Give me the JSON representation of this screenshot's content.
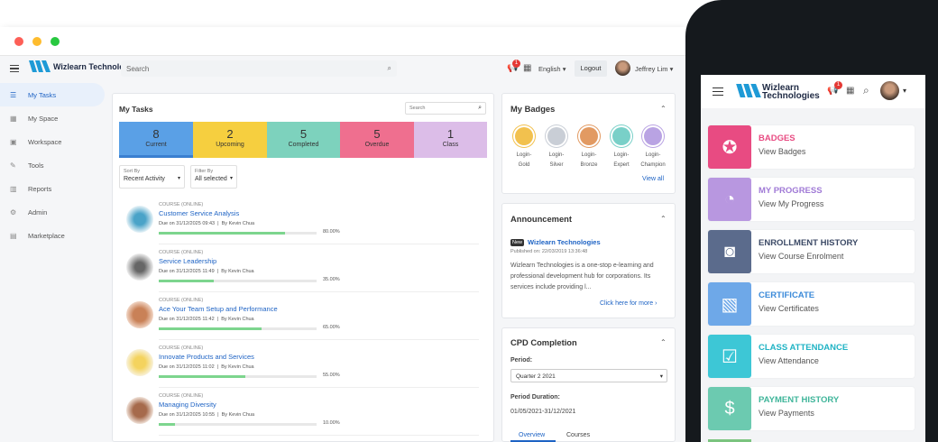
{
  "header": {
    "search_placeholder": "Search",
    "language": "English",
    "logout": "Logout",
    "user": "Jeffrey Lim",
    "notif_count": "1",
    "logo": "Wizlearn Technologies"
  },
  "sidebar": {
    "items": [
      {
        "label": "My Tasks",
        "icon": "tasks-icon"
      },
      {
        "label": "My Space",
        "icon": "grid-icon"
      },
      {
        "label": "Workspace",
        "icon": "briefcase-icon"
      },
      {
        "label": "Tools",
        "icon": "wrench-icon"
      },
      {
        "label": "Reports",
        "icon": "chart-icon"
      },
      {
        "label": "Admin",
        "icon": "gear-icon"
      },
      {
        "label": "Marketplace",
        "icon": "store-icon"
      }
    ]
  },
  "tasks": {
    "title": "My Tasks",
    "search_placeholder": "Search",
    "stats": [
      {
        "n": "8",
        "label": "Current",
        "color": "#5aa0e6"
      },
      {
        "n": "2",
        "label": "Upcoming",
        "color": "#f6cf3f"
      },
      {
        "n": "5",
        "label": "Completed",
        "color": "#7dd2bd"
      },
      {
        "n": "5",
        "label": "Overdue",
        "color": "#ef6f8f"
      },
      {
        "n": "1",
        "label": "Class",
        "color": "#dcbde8"
      }
    ],
    "sort_label": "Sort By",
    "sort_value": "Recent Activity",
    "filter_label": "Filter By",
    "filter_value": "All selected",
    "items": [
      {
        "kind": "COURSE (ONLINE)",
        "title": "Customer Service Analysis",
        "due": "Due on 31/12/2025 09:43",
        "by": "By Kevin Chua",
        "progress": "80.00%",
        "pct": 80
      },
      {
        "kind": "COURSE (ONLINE)",
        "title": "Service Leadership",
        "due": "Due on 31/12/2025 11:49",
        "by": "By Kevin Chua",
        "progress": "35.00%",
        "pct": 35
      },
      {
        "kind": "COURSE (ONLINE)",
        "title": "Ace Your Team Setup and Performance",
        "due": "Due on 31/12/2025 11:42",
        "by": "By Kevin Chua",
        "progress": "65.00%",
        "pct": 65
      },
      {
        "kind": "COURSE (ONLINE)",
        "title": "Innovate Products and Services",
        "due": "Due on 31/12/2025 11:02",
        "by": "By Kevin Chua",
        "progress": "55.00%",
        "pct": 55
      },
      {
        "kind": "COURSE (ONLINE)",
        "title": "Managing Diversity",
        "due": "Due on 31/12/2025 10:55",
        "by": "By Kevin Chua",
        "progress": "10.00%",
        "pct": 10
      }
    ]
  },
  "badges": {
    "title": "My Badges",
    "view_all": "View all",
    "items": [
      {
        "line1": "Login-",
        "line2": "Gold",
        "color": "#f2c14e"
      },
      {
        "line1": "Login-",
        "line2": "Silver",
        "color": "#c9ced6"
      },
      {
        "line1": "Login-",
        "line2": "Bronze",
        "color": "#e29a62"
      },
      {
        "line1": "Login-",
        "line2": "Expert",
        "color": "#79d0c8"
      },
      {
        "line1": "Login-",
        "line2": "Champion",
        "color": "#b9a3e3"
      }
    ]
  },
  "announcement": {
    "title": "Announcement",
    "tag": "New",
    "org": "Wizlearn Technologies",
    "published": "Published on: 22/03/2019 13:36:48",
    "body": "Wizlearn Technologies is a one-stop e-learning and professional development hub for corporations. Its services include providing l...",
    "more": "Click here for more"
  },
  "cpd": {
    "title": "CPD Completion",
    "period_label": "Period:",
    "period_value": "Quarter 2 2021",
    "duration_label": "Period Duration:",
    "duration_value": "01/05/2021-31/12/2021",
    "tab1": "Overview",
    "tab2": "Courses"
  },
  "phone": {
    "notif": "1",
    "items": [
      {
        "title": "BADGES",
        "sub": "View Badges",
        "color": "#e84b82",
        "title_color": "#e84b82"
      },
      {
        "title": "MY PROGRESS",
        "sub": "View My Progress",
        "color": "#b897e0",
        "title_color": "#a07ad6"
      },
      {
        "title": "ENROLLMENT HISTORY",
        "sub": "View Course Enrolment",
        "color": "#5b6b8c",
        "title_color": "#3c4a66"
      },
      {
        "title": "CERTIFICATE",
        "sub": "View Certificates",
        "color": "#6ea8e8",
        "title_color": "#3b8ad9"
      },
      {
        "title": "CLASS ATTENDANCE",
        "sub": "View Attendance",
        "color": "#3dc7d6",
        "title_color": "#1fb3c4"
      },
      {
        "title": "PAYMENT HISTORY",
        "sub": "View Payments",
        "color": "#6ccab0",
        "title_color": "#3fb59a"
      }
    ]
  }
}
